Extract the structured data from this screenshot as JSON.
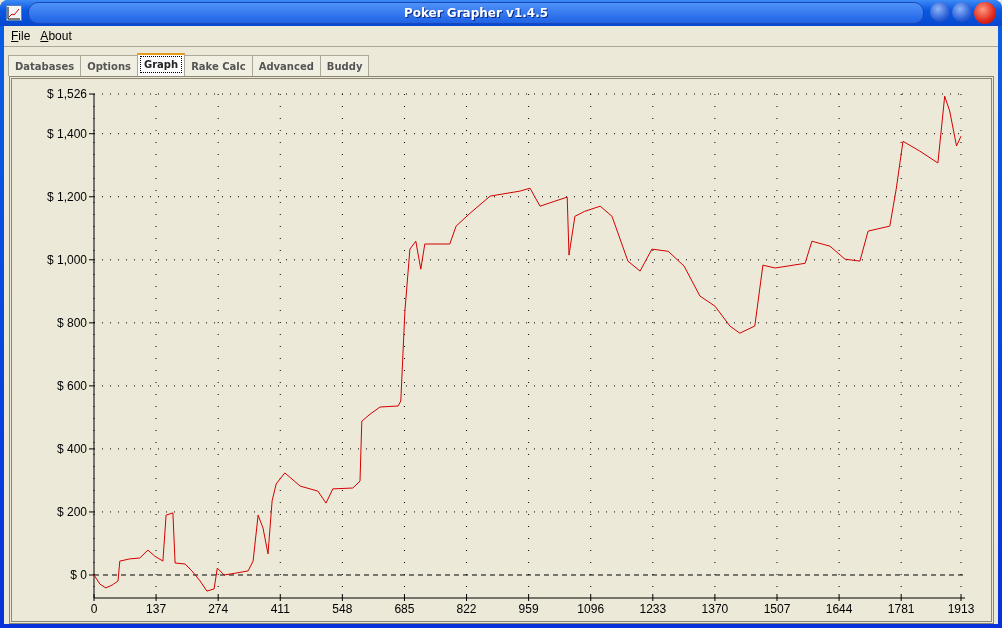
{
  "window": {
    "title": "Poker Grapher v1.4.5"
  },
  "menu": [
    {
      "label": "File"
    },
    {
      "label": "About"
    }
  ],
  "tabs": [
    {
      "label": "Databases",
      "selected": false
    },
    {
      "label": "Options",
      "selected": false
    },
    {
      "label": "Graph",
      "selected": true
    },
    {
      "label": "Rake Calc",
      "selected": false
    },
    {
      "label": "Advanced",
      "selected": false
    },
    {
      "label": "Buddy",
      "selected": false
    }
  ],
  "graph": {
    "chart_data": {
      "type": "line",
      "grid": true,
      "xlim": [
        0,
        1913
      ],
      "ylim": [
        -73,
        1526
      ],
      "xticks": [
        0,
        137,
        274,
        411,
        548,
        685,
        822,
        959,
        1096,
        1233,
        1370,
        1507,
        1644,
        1781,
        1913
      ],
      "yticks": [
        {
          "value": 0,
          "label": "$ 0"
        },
        {
          "value": 200,
          "label": "$ 200"
        },
        {
          "value": 400,
          "label": "$ 400"
        },
        {
          "value": 600,
          "label": "$ 600"
        },
        {
          "value": 800,
          "label": "$ 800"
        },
        {
          "value": 1000,
          "label": "$ 1,000"
        },
        {
          "value": 1200,
          "label": "$ 1,200"
        },
        {
          "value": 1400,
          "label": "$ 1,400"
        },
        {
          "value": 1526,
          "label": "$ 1,526"
        }
      ],
      "x": [
        0,
        13,
        26,
        40,
        53,
        57,
        79,
        101,
        119,
        134,
        152,
        159,
        174,
        179,
        201,
        216,
        234,
        249,
        265,
        272,
        287,
        313,
        340,
        351,
        362,
        373,
        384,
        393,
        402,
        421,
        455,
        494,
        512,
        527,
        571,
        587,
        591,
        609,
        631,
        671,
        677,
        686,
        697,
        710,
        721,
        730,
        785,
        799,
        830,
        874,
        940,
        962,
        984,
        1017,
        1044,
        1048,
        1061,
        1083,
        1117,
        1143,
        1178,
        1205,
        1231,
        1267,
        1302,
        1337,
        1370,
        1403,
        1425,
        1458,
        1476,
        1503,
        1569,
        1584,
        1624,
        1657,
        1690,
        1708,
        1756,
        1770,
        1785,
        1822,
        1862,
        1877,
        1888,
        1903,
        1913
      ],
      "series": [
        {
          "color": "#d40000",
          "values": [
            0,
            -29,
            -41,
            -32,
            -19,
            44,
            51,
            54,
            79,
            60,
            44,
            190,
            197,
            38,
            35,
            13,
            -19,
            -51,
            -44,
            22,
            0,
            6,
            13,
            44,
            190,
            149,
            67,
            235,
            289,
            324,
            282,
            266,
            228,
            273,
            276,
            298,
            488,
            510,
            533,
            536,
            552,
            837,
            1034,
            1059,
            970,
            1050,
            1050,
            1107,
            1148,
            1202,
            1218,
            1227,
            1170,
            1186,
            1199,
            1015,
            1138,
            1154,
            1170,
            1138,
            996,
            964,
            1034,
            1027,
            980,
            885,
            853,
            790,
            767,
            790,
            983,
            974,
            989,
            1059,
            1043,
            1002,
            996,
            1091,
            1107,
            1224,
            1376,
            1345,
            1307,
            1519,
            1472,
            1361,
            1392
          ]
        }
      ]
    }
  }
}
